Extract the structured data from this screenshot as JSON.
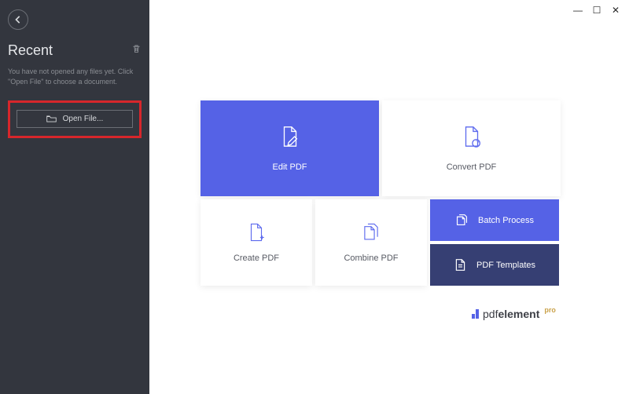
{
  "sidebar": {
    "title": "Recent",
    "hint": "You have not opened any files yet. Click \"Open File\" to choose a document.",
    "open_label": "Open File..."
  },
  "tiles": {
    "edit": "Edit PDF",
    "convert": "Convert PDF",
    "create": "Create PDF",
    "combine": "Combine PDF",
    "batch": "Batch Process",
    "templates": "PDF Templates"
  },
  "brand": {
    "light": "pdf",
    "bold": "element",
    "suffix": "pro"
  },
  "win": {
    "min": "—",
    "max": "☐",
    "close": "✕"
  }
}
